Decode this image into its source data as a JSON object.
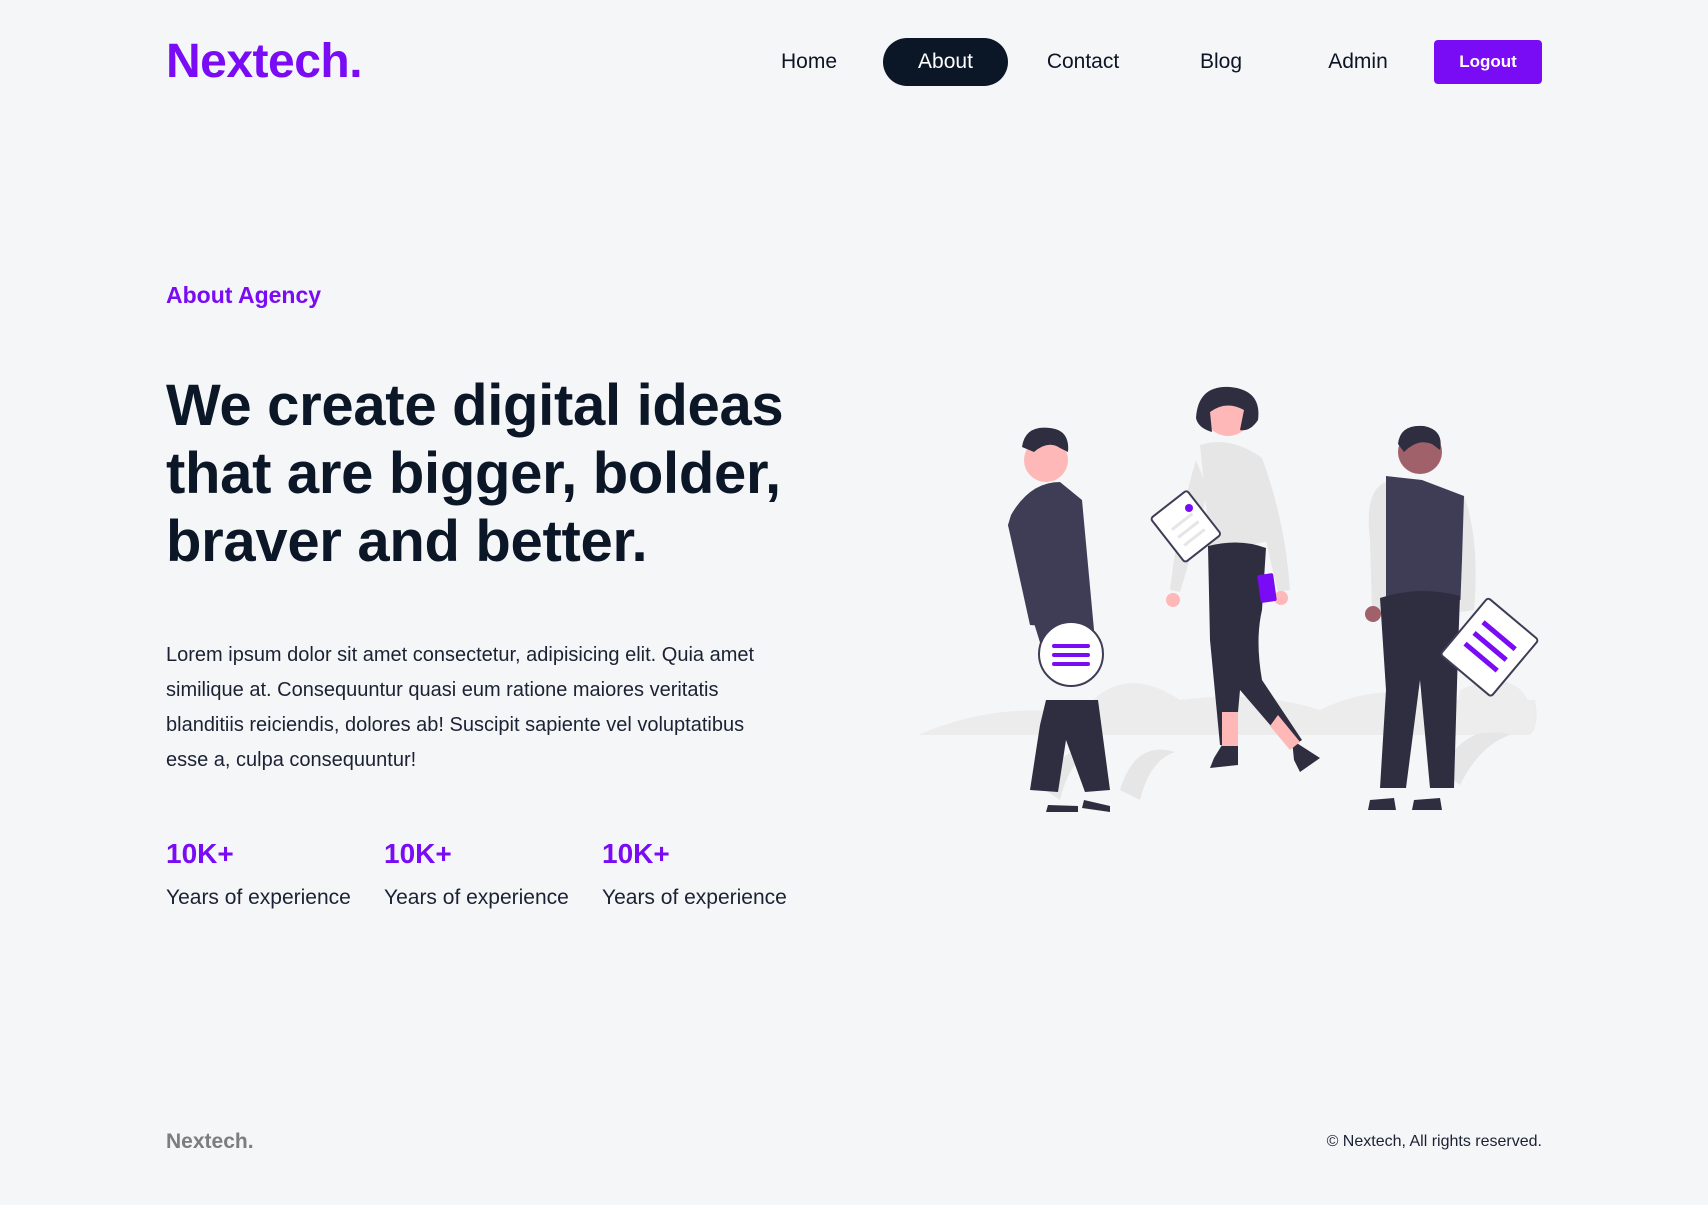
{
  "header": {
    "logo": "Nextech.",
    "nav": [
      {
        "label": "Home",
        "active": false
      },
      {
        "label": "About",
        "active": true
      },
      {
        "label": "Contact",
        "active": false
      },
      {
        "label": "Blog",
        "active": false
      },
      {
        "label": "Admin",
        "active": false
      }
    ],
    "logout_label": "Logout"
  },
  "hero": {
    "eyebrow": "About Agency",
    "headline": "We create digital ideas that are bigger, bolder, braver and better.",
    "body": "Lorem ipsum dolor sit amet consectetur, adipisicing elit. Quia amet similique at. Consequuntur quasi eum ratione maiores veritatis blanditiis reiciendis, dolores ab! Suscipit sapiente vel voluptatibus esse a, culpa consequuntur!"
  },
  "stats": [
    {
      "value": "10K+",
      "label": "Years of experience"
    },
    {
      "value": "10K+",
      "label": "Years of experience"
    },
    {
      "value": "10K+",
      "label": "Years of experience"
    }
  ],
  "illustration": {
    "icon": "team-people-illustration"
  },
  "footer": {
    "logo": "Nextech.",
    "copyright": "© Nextech, All rights reserved."
  },
  "colors": {
    "accent": "#7a0bf5",
    "dark": "#0b1627",
    "background": "#f5f6f8"
  }
}
